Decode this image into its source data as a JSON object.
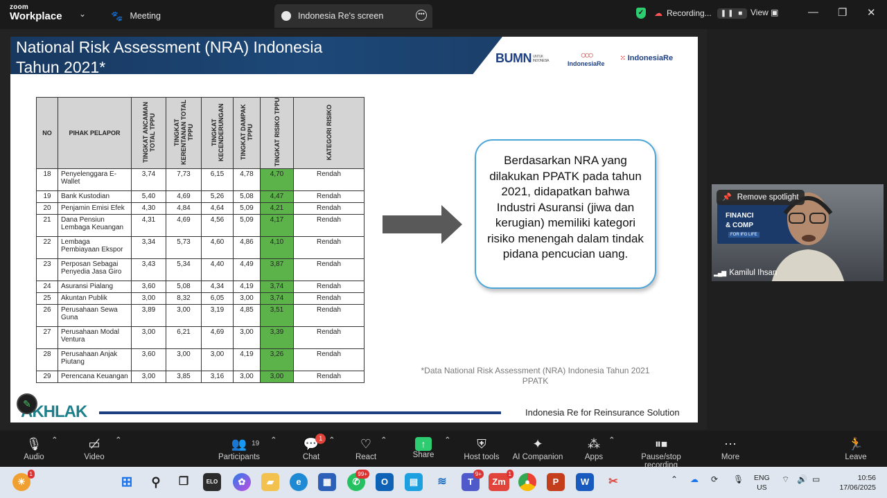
{
  "app": {
    "brand_small": "zoom",
    "brand_big": "Workplace",
    "tab_meeting": "Meeting",
    "tab_screen": "Indonesia Re's screen",
    "recording": "Recording...",
    "view": "View"
  },
  "slide": {
    "title_line1": "National Risk Assessment (NRA) Indonesia",
    "title_line2": "Tahun 2021*",
    "logo_bumn": "BUMN",
    "logo_bumn_sub": "UNTUK INDONESIA",
    "logo_re": "IndonesiaRe",
    "logo_institute": "IndonesiaRe",
    "table": {
      "headers": [
        "NO",
        "PIHAK PELAPOR",
        "TINGKAT ANCAMAN TOTAL TPPU",
        "TINGKAT KERENTANAN TOTAL TPPU",
        "TINGKAT KECENDERUNGAN",
        "TINGKAT DAMPAK TPPU",
        "TINGKAT RISIKO TPPU",
        "KATEGORI RISIKO"
      ],
      "rows": [
        {
          "no": "18",
          "name": "Penyelenggara E-Wallet",
          "a": "3,74",
          "k": "7,73",
          "c": "6,15",
          "d": "4,78",
          "r": "4,70",
          "cat": "Rendah"
        },
        {
          "no": "19",
          "name": "Bank Kustodian",
          "a": "5,40",
          "k": "4,69",
          "c": "5,26",
          "d": "5,08",
          "r": "4,47",
          "cat": "Rendah"
        },
        {
          "no": "20",
          "name": "Penjamin Emisi Efek",
          "a": "4,30",
          "k": "4,84",
          "c": "4,64",
          "d": "5,09",
          "r": "4,21",
          "cat": "Rendah"
        },
        {
          "no": "21",
          "name": "Dana Pensiun Lembaga Keuangan",
          "a": "4,31",
          "k": "4,69",
          "c": "4,56",
          "d": "5,09",
          "r": "4,17",
          "cat": "Rendah"
        },
        {
          "no": "22",
          "name": "Lembaga Pembiayaan Ekspor",
          "a": "3,34",
          "k": "5,73",
          "c": "4,60",
          "d": "4,86",
          "r": "4,10",
          "cat": "Rendah"
        },
        {
          "no": "23",
          "name": "Perposan Sebagai Penyedia Jasa Giro",
          "a": "3,43",
          "k": "5,34",
          "c": "4,40",
          "d": "4,49",
          "r": "3,87",
          "cat": "Rendah"
        },
        {
          "no": "24",
          "name": "Asuransi Pialang",
          "a": "3,60",
          "k": "5,08",
          "c": "4,34",
          "d": "4,19",
          "r": "3,74",
          "cat": "Rendah"
        },
        {
          "no": "25",
          "name": "Akuntan Publik",
          "a": "3,00",
          "k": "8,32",
          "c": "6,05",
          "d": "3,00",
          "r": "3,74",
          "cat": "Rendah"
        },
        {
          "no": "26",
          "name": "Perusahaan Sewa Guna",
          "a": "3,89",
          "k": "3,00",
          "c": "3,19",
          "d": "4,85",
          "r": "3,51",
          "cat": "Rendah"
        },
        {
          "no": "27",
          "name": "Perusahaan Modal Ventura",
          "a": "3,00",
          "k": "6,21",
          "c": "4,69",
          "d": "3,00",
          "r": "3,39",
          "cat": "Rendah"
        },
        {
          "no": "28",
          "name": "Perusahaan Anjak Piutang",
          "a": "3,60",
          "k": "3,00",
          "c": "3,00",
          "d": "4,19",
          "r": "3,26",
          "cat": "Rendah"
        },
        {
          "no": "29",
          "name": "Perencana Keuangan",
          "a": "3,00",
          "k": "3,85",
          "c": "3,16",
          "d": "3,00",
          "r": "3,00",
          "cat": "Rendah"
        }
      ]
    },
    "bubble_text": "Berdasarkan NRA yang dilakukan PPATK pada tahun 2021, didapatkan bahwa Industri Asuransi (jiwa dan kerugian) memiliki kategori risiko menengah dalam tindak pidana pencucian uang.",
    "footnote": "*Data National Risk Assessment (NRA) Indonesia Tahun 2021 PPATK",
    "akhlak": "AKHLAK",
    "footer": "Indonesia Re for Reinsurance Solution"
  },
  "video": {
    "remove_spotlight": "Remove spotlight",
    "participant_name": "Kamilul Ihsan",
    "banner_line1": "FINANCI",
    "banner_line2": "& COMP",
    "banner_line3": "FOR IFG LIFE"
  },
  "toolbar": {
    "audio": "Audio",
    "video": "Video",
    "participants": "Participants",
    "participants_count": "19",
    "chat": "Chat",
    "chat_badge": "1",
    "react": "React",
    "share": "Share",
    "host_tools": "Host tools",
    "ai_companion": "AI Companion",
    "apps": "Apps",
    "pause_stop": "Pause/stop recording",
    "more": "More",
    "leave": "Leave"
  },
  "taskbar": {
    "weather_badge": "1",
    "whatsapp_badge": "99+",
    "teams_badge": "9+",
    "zoom_badge": "1",
    "elo_label": "ELO",
    "lang_top": "ENG",
    "lang_bottom": "US",
    "time": "10:56",
    "date": "17/06/2025"
  },
  "colors": {
    "risk_green": "#5bb349",
    "header_navy": "#1d4878",
    "bubble_border": "#4aa6d8",
    "share_green": "#2ecc71"
  }
}
